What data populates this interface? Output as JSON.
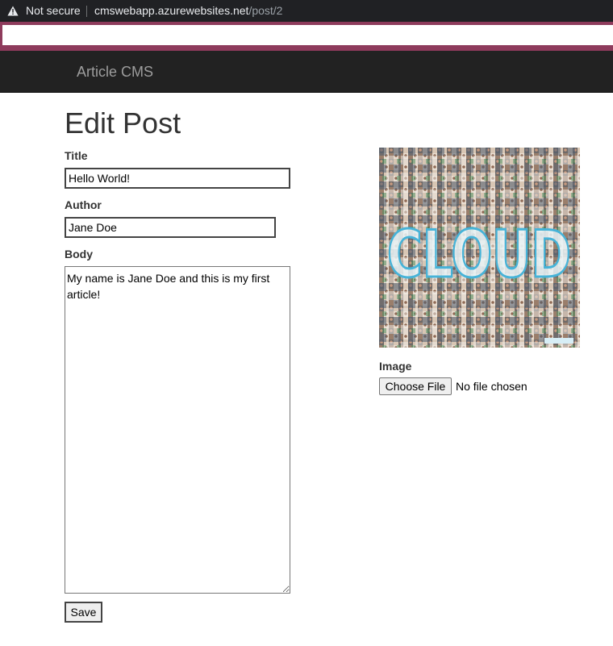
{
  "browser": {
    "security_label": "Not secure",
    "url_host": "cmswebapp.azurewebsites.net",
    "url_path": "/post/2",
    "find_value": ""
  },
  "navbar": {
    "brand": "Article CMS"
  },
  "page": {
    "title": "Edit Post"
  },
  "form": {
    "title_label": "Title",
    "title_value": "Hello World!",
    "author_label": "Author",
    "author_value": "Jane Doe",
    "body_label": "Body",
    "body_value": "My name is Jane Doe and this is my first article!",
    "image_label": "Image",
    "image_alt_text": "CLOUD",
    "choose_file_label": "Choose File",
    "no_file_text": "No file chosen",
    "save_label": "Save"
  }
}
